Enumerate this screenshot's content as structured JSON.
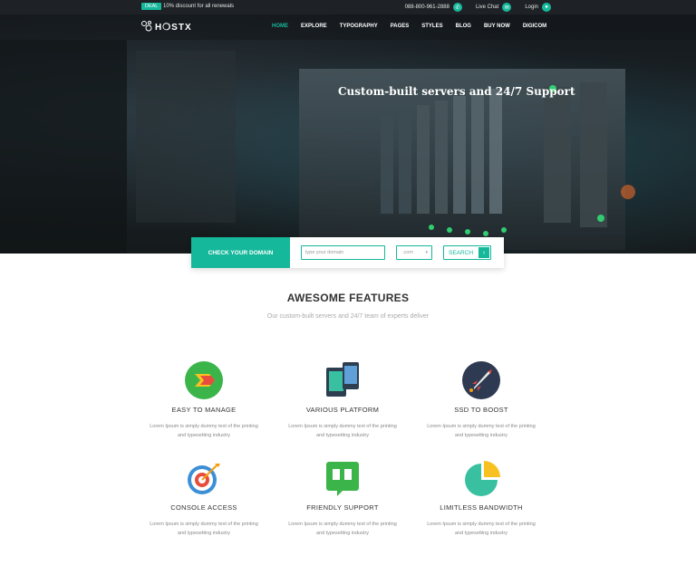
{
  "topbar": {
    "deal_badge": "DEAL",
    "deal_text": "10% discount for all renewals",
    "phone": "088-800-961-2888",
    "live_chat": "Live Chat",
    "login": "Login"
  },
  "brand": {
    "logo_text": "H❍STX"
  },
  "nav": {
    "items": [
      "HOME",
      "EXPLORE",
      "TYPOGRAPHY",
      "PAGES",
      "STYLES",
      "BLOG",
      "BUY NOW",
      "DIGICOM"
    ],
    "active": "HOME"
  },
  "hero": {
    "title": "Custom-built servers and 24/7 Support"
  },
  "domain_search": {
    "label": "CHECK YOUR DOMAIN",
    "placeholder": "type your domain",
    "tld": ".com",
    "button": "SEARCH"
  },
  "features": {
    "title": "AWESOME FEATURES",
    "subtitle": "Our custom-built servers and 24/7 team of experts deliver",
    "items": [
      {
        "title": "EASY TO MANAGE",
        "desc1": "Lorem Ipsum is simply dummy text of the printing",
        "desc2": "and typesetting industry",
        "icon": "arrow-badge-icon"
      },
      {
        "title": "VARIOUS PLATFORM",
        "desc1": "Lorem Ipsum is simply dummy text of the printing",
        "desc2": "and typesetting industry",
        "icon": "devices-icon"
      },
      {
        "title": "SSD TO BOOST",
        "desc1": "Lorem Ipsum is simply dummy text of the printing",
        "desc2": "and typesetting industry",
        "icon": "rocket-icon"
      },
      {
        "title": "CONSOLE ACCESS",
        "desc1": "Lorem Ipsum is simply dummy text of the printing",
        "desc2": "and typesetting industry",
        "icon": "target-icon"
      },
      {
        "title": "FRIENDLY SUPPORT",
        "desc1": "Lorem Ipsum is simply dummy text of the printing",
        "desc2": "and typesetting industry",
        "icon": "chat-quote-icon"
      },
      {
        "title": "LIMITLESS BANDWIDTH",
        "desc1": "Lorem Ipsum is simply dummy text of the printing",
        "desc2": "and typesetting industry",
        "icon": "pie-chart-icon"
      }
    ]
  },
  "colors": {
    "accent": "#16b89b",
    "topbar": "#1e2226"
  }
}
